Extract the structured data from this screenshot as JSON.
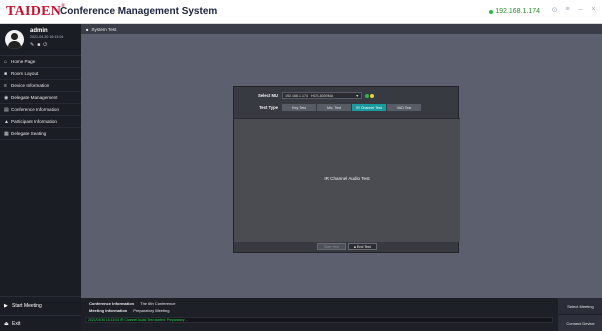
{
  "titlebar": {
    "logo": "TAIDEN",
    "logo_mark": "®",
    "title": "Conference Management System",
    "ip": "192.168.1.174",
    "controls": [
      "⊙",
      "≡",
      "–",
      "×"
    ]
  },
  "user": {
    "name": "admin",
    "datetime": "2021-04-30 16:13:04",
    "icons": [
      "✎",
      "■",
      "⏻"
    ]
  },
  "sidebar": {
    "items": [
      {
        "icon": "home-icon",
        "glyph": "⌂",
        "label": "Home Page"
      },
      {
        "icon": "room-icon",
        "glyph": "■",
        "label": "Room Layout"
      },
      {
        "icon": "device-icon",
        "glyph": "≡",
        "label": "Device Information"
      },
      {
        "icon": "delegate-icon",
        "glyph": "◉",
        "label": "Delegate Management"
      },
      {
        "icon": "conference-icon",
        "glyph": "▤",
        "label": "Conference Information"
      },
      {
        "icon": "participant-icon",
        "glyph": "▲",
        "label": "Participant Information"
      },
      {
        "icon": "seating-icon",
        "glyph": "▦",
        "label": "Delegate Seating"
      }
    ],
    "start_meeting": "Start Meeting",
    "exit": "Exit"
  },
  "breadcrumb": "System Test",
  "dialog": {
    "select_mu_label": "Select MU",
    "select_mu_value": "192.168.1.174",
    "select_mu_extra": "HCS-8300MA",
    "test_type_label": "Test Type",
    "tabs": [
      "Key Test",
      "Mic. Test",
      "IR Channel Test",
      "VAD Test"
    ],
    "selected_tab": 2,
    "body_text": "IR Channel Audio Test",
    "start_label": "Start Test",
    "end_label": "End Test"
  },
  "infobar": {
    "conf_label": "Conference Information",
    "conf_value": "The 6th Conference",
    "meeting_label": "Meeting Information",
    "meeting_value": "Preparatory Meeting",
    "marquee": "2021/04/30 16:13:04 IR Channel Audio Test started: Preparatory ..."
  },
  "right_buttons": {
    "select_meeting": "Select Meeting",
    "connect_device": "Connect Device"
  },
  "colors": {
    "accent_teal": "#1b9aa0",
    "brand_red": "#c8102e",
    "status_green": "#2db84a",
    "mu_dot_green": "#2db84a",
    "mu_dot_yellow": "#e8d23a"
  }
}
